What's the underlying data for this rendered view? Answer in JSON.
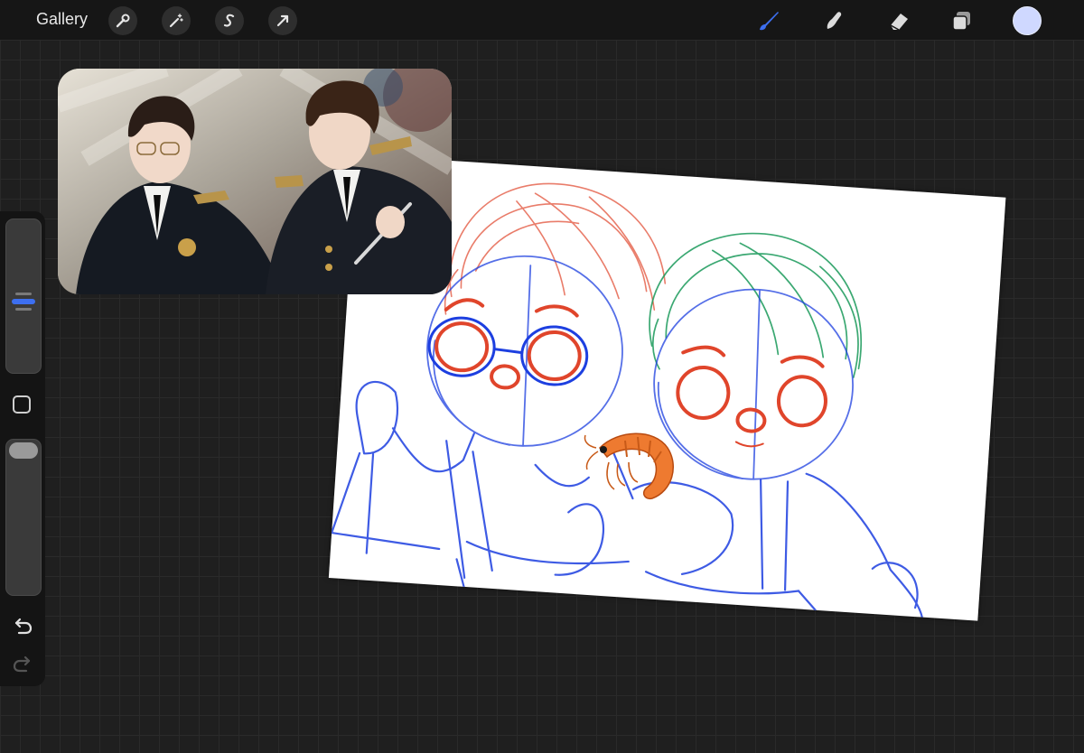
{
  "toolbar": {
    "gallery_label": "Gallery",
    "left_tools": [
      "wrench-icon",
      "magic-wand-icon",
      "selection-s-icon",
      "arrow-icon"
    ],
    "right_tools": [
      "brush-icon",
      "smudge-icon",
      "eraser-icon",
      "layers-icon"
    ],
    "active_tool": "brush-icon",
    "accent_color": "#3d6ff0",
    "current_color": "#cfd8ff"
  },
  "sidebar": {
    "controls": [
      "brush-size-slider",
      "modify-button",
      "opacity-slider",
      "undo-button",
      "redo-button"
    ]
  },
  "colors": {
    "sketch_blue": "#1d3fe0",
    "sketch_red": "#e0452b",
    "sketch_green": "#1a9a5a"
  }
}
